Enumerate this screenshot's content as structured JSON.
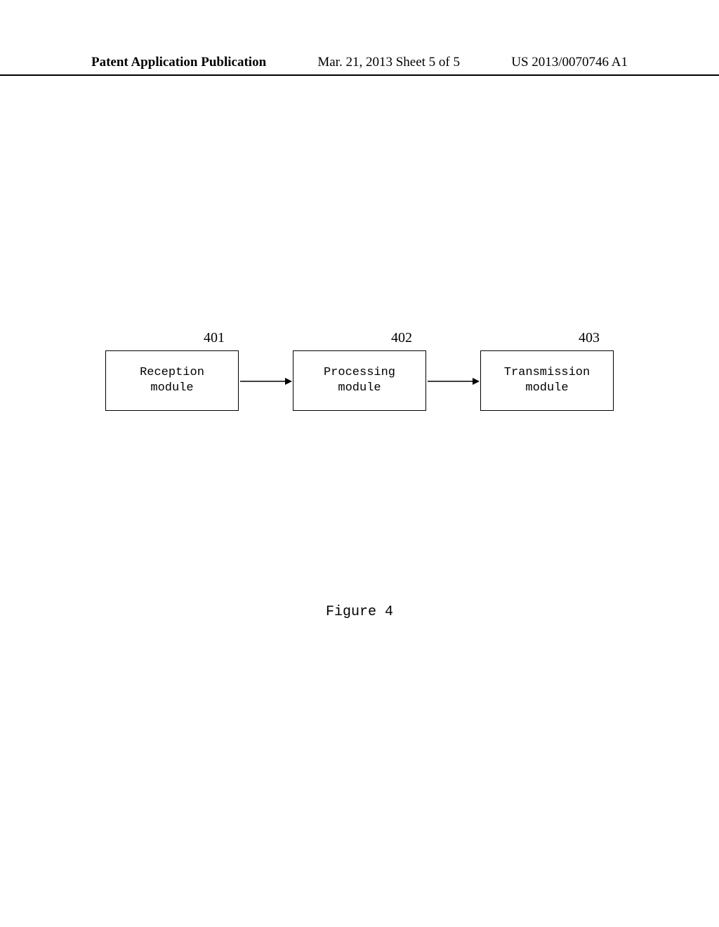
{
  "header": {
    "left": "Patent Application Publication",
    "mid": "Mar. 21, 2013  Sheet 5 of 5",
    "right": "US 2013/0070746 A1"
  },
  "diagram": {
    "blocks": [
      {
        "ref": "401",
        "label": "Reception\nmodule"
      },
      {
        "ref": "402",
        "label": "Processing\nmodule"
      },
      {
        "ref": "403",
        "label": "Transmission\nmodule"
      }
    ]
  },
  "caption": "Figure 4"
}
